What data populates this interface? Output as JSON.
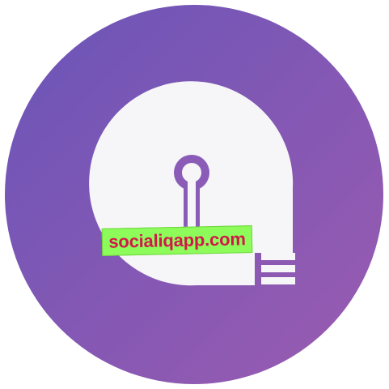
{
  "icon": {
    "name": "lock-app-icon",
    "colors": {
      "gradient_start": "#6a55b8",
      "gradient_end": "#9b5bb0",
      "foreground": "#f6f6f8",
      "keyhole": "#8a5cb8"
    }
  },
  "watermark": {
    "text": "socialiqapp.com",
    "colors": {
      "background": "#8dfc5a",
      "text": "#d1184a"
    }
  }
}
